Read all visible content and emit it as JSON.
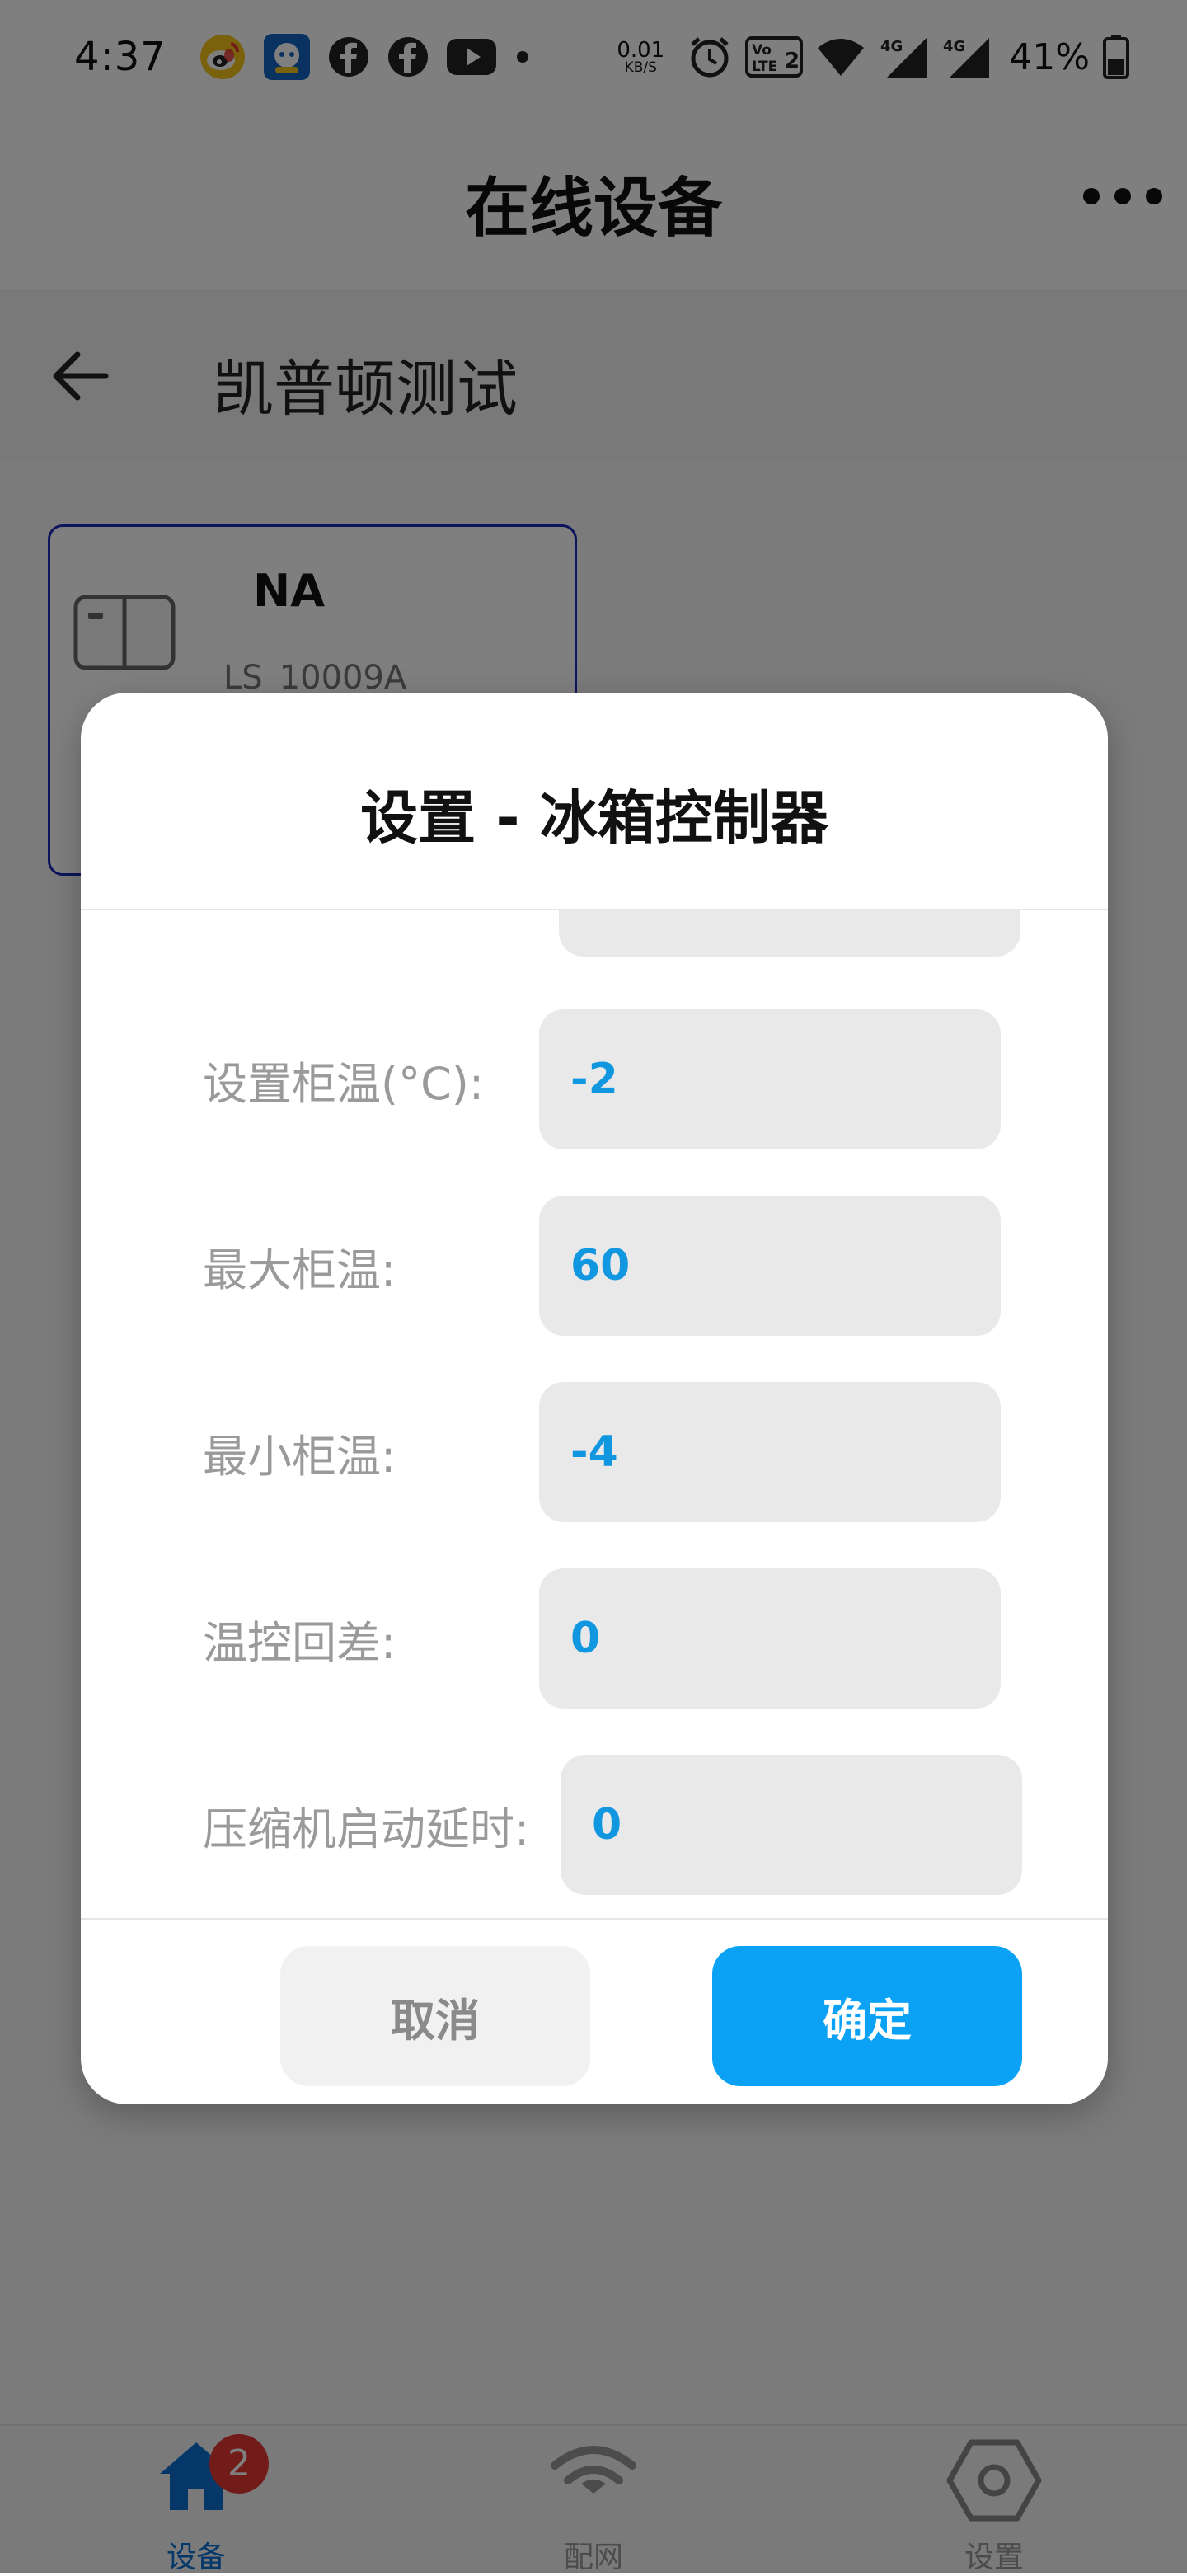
{
  "status_bar": {
    "time": "4:37",
    "net_speed_value": "0.01",
    "net_speed_unit": "KB/S",
    "battery_percent": "41%",
    "icons": [
      "weibo-icon",
      "app-icon",
      "facebook-icon",
      "facebook-icon",
      "youtube-icon",
      "dot-icon",
      "alarm-icon",
      "volte-icon",
      "wifi-icon",
      "4g-signal-icon",
      "4g-signal-icon",
      "battery-icon"
    ]
  },
  "title_bar": {
    "title": "在线设备",
    "more_icon": "more-icon"
  },
  "nav_header": {
    "title": "凯普顿测试",
    "back_icon": "back-arrow-icon"
  },
  "device_card": {
    "name": "NA",
    "id": "LS_10009A",
    "icon": "device-switch-icon"
  },
  "dialog": {
    "title": "设置 - 冰箱控制器",
    "fields": [
      {
        "label": "设置柜温(°C):",
        "value": "-2"
      },
      {
        "label": "最大柜温:",
        "value": "60"
      },
      {
        "label": "最小柜温:",
        "value": "-4"
      },
      {
        "label": "温控回差:",
        "value": "0"
      },
      {
        "label": "压缩机启动延时:",
        "value": "0"
      }
    ],
    "cancel_label": "取消",
    "confirm_label": "确定"
  },
  "tab_bar": {
    "items": [
      {
        "label": "设备",
        "icon": "home-icon",
        "badge": "2",
        "active": true
      },
      {
        "label": "配网",
        "icon": "wifi-icon",
        "active": false
      },
      {
        "label": "设置",
        "icon": "settings-icon",
        "active": false
      }
    ]
  },
  "colors": {
    "accent": "#0ba2f6",
    "value_text": "#1197e0",
    "badge": "#e53935",
    "card_border": "#1b2bb8",
    "active_tab": "#0a6fd3"
  }
}
